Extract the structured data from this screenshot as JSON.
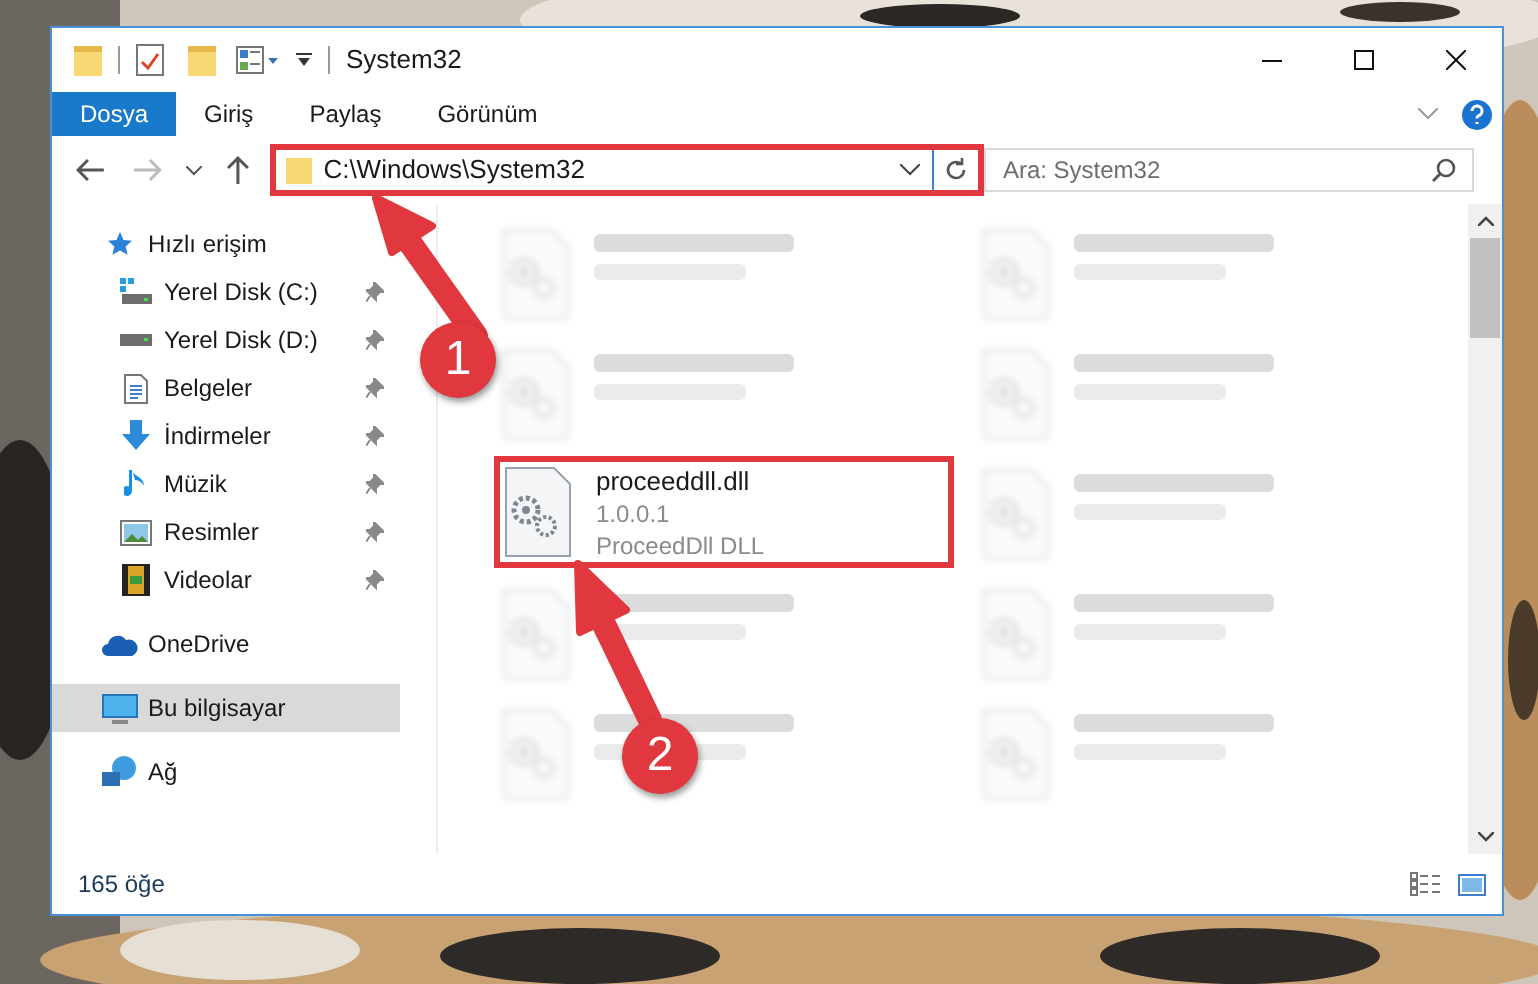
{
  "window": {
    "title": "System32"
  },
  "ribbon_tabs": [
    {
      "label": "Dosya",
      "selected": true
    },
    {
      "label": "Giriş",
      "selected": false
    },
    {
      "label": "Paylaş",
      "selected": false
    },
    {
      "label": "Görünüm",
      "selected": false
    }
  ],
  "address_bar": {
    "path": "C:\\Windows\\System32",
    "highlighted": true
  },
  "search": {
    "placeholder": "Ara: System32"
  },
  "sidebar": {
    "items": [
      {
        "label": "Hızlı erişim",
        "kind": "star",
        "selected": false,
        "children": [
          {
            "label": "Yerel Disk (C:)",
            "kind": "drive-windows",
            "pinned": true,
            "selected": false
          },
          {
            "label": "Yerel Disk (D:)",
            "kind": "drive",
            "pinned": true,
            "selected": false
          },
          {
            "label": "Belgeler",
            "kind": "documents",
            "pinned": true,
            "selected": false
          },
          {
            "label": "İndirmeler",
            "kind": "downloads",
            "pinned": true,
            "selected": false
          },
          {
            "label": "Müzik",
            "kind": "music",
            "pinned": true,
            "selected": false
          },
          {
            "label": "Resimler",
            "kind": "pictures",
            "pinned": true,
            "selected": false
          },
          {
            "label": "Videolar",
            "kind": "videos",
            "pinned": true,
            "selected": false
          }
        ]
      },
      {
        "label": "OneDrive",
        "kind": "cloud",
        "selected": false
      },
      {
        "label": "Bu bilgisayar",
        "kind": "computer",
        "selected": true
      },
      {
        "label": "Ağ",
        "kind": "network",
        "selected": false
      }
    ]
  },
  "files": [
    {
      "blurred": true
    },
    {
      "blurred": true
    },
    {
      "blurred": true
    },
    {
      "blurred": true
    },
    {
      "lines": [
        "proceeddll.dll",
        "1.0.0.1",
        "ProceedDll DLL"
      ],
      "blurred": false,
      "highlighted": true
    },
    {
      "blurred": true
    },
    {
      "blurred": true
    },
    {
      "blurred": true
    },
    {
      "blurred": true
    },
    {
      "blurred": true
    }
  ],
  "status_bar": {
    "count": "165 öğe"
  },
  "annotations": [
    {
      "number": "1"
    },
    {
      "number": "2"
    }
  ]
}
